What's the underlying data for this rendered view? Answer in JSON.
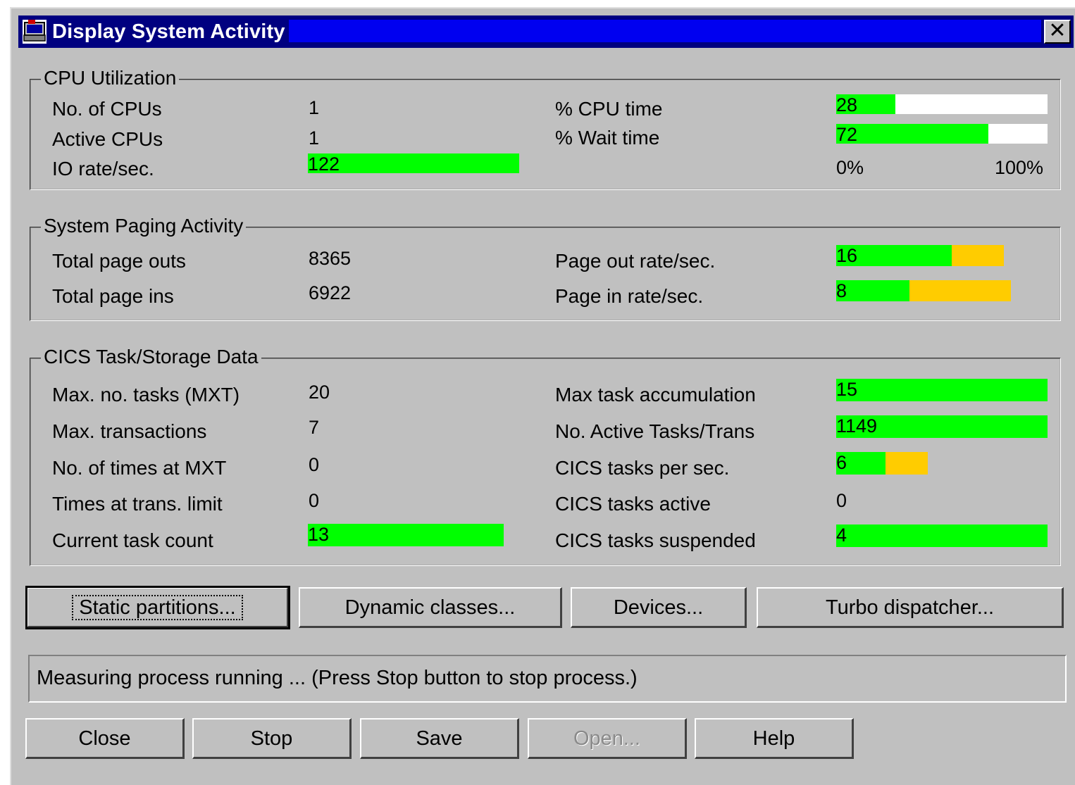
{
  "window": {
    "title": "Display System Activity",
    "close_glyph": "✕"
  },
  "colors": {
    "good": "#00ff00",
    "warn": "#ffcc00",
    "track": "#ffffff",
    "title_bar": "#000080"
  },
  "cpu": {
    "title": "CPU Utilization",
    "no_cpus_label": "No. of CPUs",
    "no_cpus": "1",
    "active_cpus_label": "Active CPUs",
    "active_cpus": "1",
    "io_rate_label": "IO rate/sec.",
    "io_rate": "122",
    "cpu_time_label": "% CPU time",
    "cpu_time": "28",
    "cpu_time_pct": 28,
    "wait_time_label": "% Wait time",
    "wait_time": "72",
    "wait_time_pct": 72,
    "scale_min": "0%",
    "scale_max": "100%"
  },
  "paging": {
    "title": "System Paging Activity",
    "total_outs_label": "Total page outs",
    "total_outs": "8365",
    "total_ins_label": "Total page ins",
    "total_ins": "6922",
    "out_rate_label": "Page out rate/sec.",
    "out_rate": "16",
    "in_rate_label": "Page in rate/sec.",
    "in_rate": "8"
  },
  "cics": {
    "title": "CICS Task/Storage Data",
    "max_tasks_label": "Max. no. tasks (MXT)",
    "max_tasks": "20",
    "max_trans_label": "Max. transactions",
    "max_trans": "7",
    "times_mxt_label": "No. of times at MXT",
    "times_mxt": "0",
    "times_trans_label": "Times at trans. limit",
    "times_trans": "0",
    "current_label": "Current task count",
    "current": "13",
    "max_accum_label": "Max task accumulation",
    "max_accum": "15",
    "active_trans_label": "No. Active Tasks/Trans",
    "active_trans": "1149",
    "per_sec_label": "CICS tasks per sec.",
    "per_sec": "6",
    "active_label": "CICS tasks active",
    "active": "0",
    "suspended_label": "CICS tasks suspended",
    "suspended": "4"
  },
  "buttons": {
    "static": "Static partitions...",
    "dynamic": "Dynamic classes...",
    "devices": "Devices...",
    "turbo": "Turbo dispatcher...",
    "close": "Close",
    "stop": "Stop",
    "save": "Save",
    "open": "Open...",
    "help": "Help"
  },
  "status_text": "Measuring process running ... (Press Stop button to stop process.)"
}
